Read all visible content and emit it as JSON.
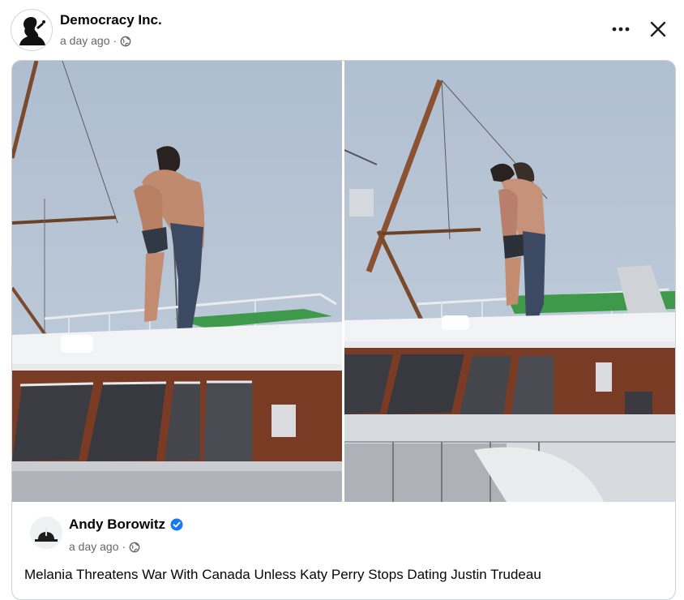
{
  "post": {
    "page_name": "Democracy Inc.",
    "timestamp": "a day ago",
    "separator": "·",
    "privacy_icon": "globe-icon",
    "more_icon": "more-options-icon",
    "close_icon": "close-icon"
  },
  "shared": {
    "author_name": "Andy Borowitz",
    "verified_icon": "verified-badge-icon",
    "timestamp": "a day ago",
    "separator": "·",
    "privacy_icon": "globe-icon",
    "text": "Melania Threatens War With Canada Unless Katy Perry Stops Dating Justin Trudeau"
  },
  "colors": {
    "text_primary": "#050505",
    "text_secondary": "#65676b",
    "verified_blue": "#1877f2",
    "border": "#ced0d4"
  }
}
